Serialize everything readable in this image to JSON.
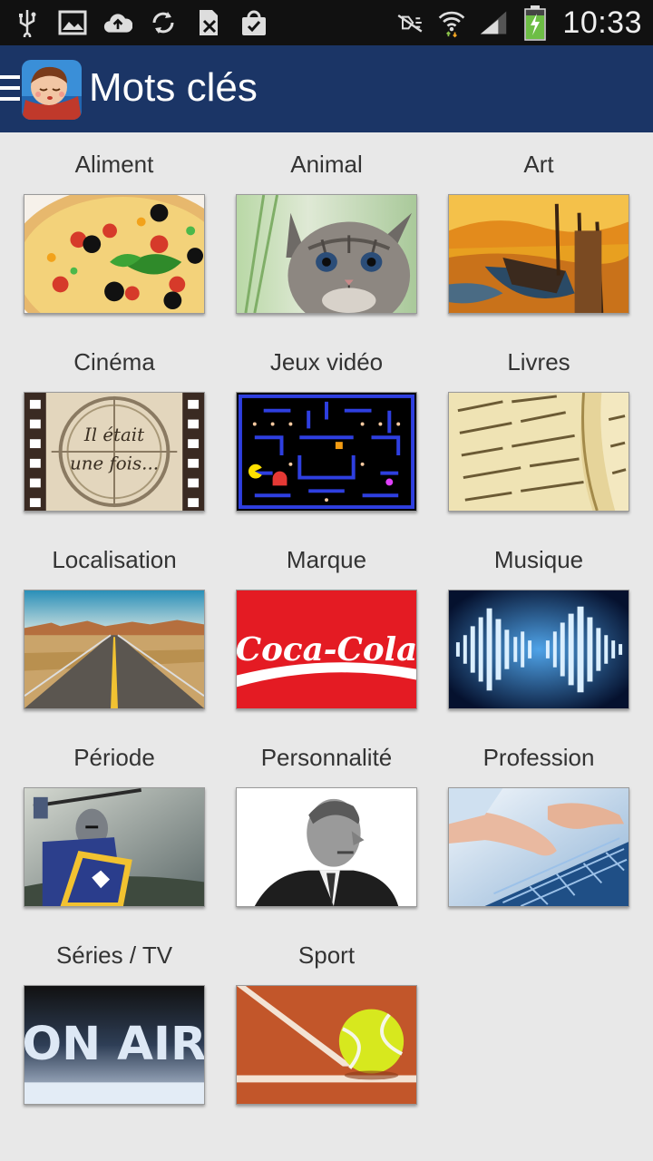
{
  "status_bar": {
    "time": "10:33",
    "icons_left": [
      "usb-icon",
      "image-icon",
      "cloud-upload-icon",
      "sync-icon",
      "sim-card-icon",
      "shopping-bag-icon"
    ],
    "icons_right": [
      "mute-icon",
      "wifi-icon",
      "signal-icon",
      "battery-charging-icon"
    ]
  },
  "action_bar": {
    "title": "Mots clés",
    "background": "#1b3566"
  },
  "categories": [
    {
      "label": "Aliment",
      "image": "pizza"
    },
    {
      "label": "Animal",
      "image": "kitten"
    },
    {
      "label": "Art",
      "image": "painting"
    },
    {
      "label": "Cinéma",
      "image": "film-reel"
    },
    {
      "label": "Jeux vidéo",
      "image": "pacman"
    },
    {
      "label": "Livres",
      "image": "open-book"
    },
    {
      "label": "Localisation",
      "image": "desert-road"
    },
    {
      "label": "Marque",
      "image": "coca-cola-logo"
    },
    {
      "label": "Musique",
      "image": "audio-waves"
    },
    {
      "label": "Période",
      "image": "knight"
    },
    {
      "label": "Personnalité",
      "image": "portrait"
    },
    {
      "label": "Profession",
      "image": "keyboard"
    },
    {
      "label": "Séries / TV",
      "image": "on-air-sign"
    },
    {
      "label": "Sport",
      "image": "tennis-ball"
    }
  ],
  "image_text": {
    "cinema_line1": "Il était",
    "cinema_line2": "une fois...",
    "brand": "Coca-Cola",
    "tv": "ON AIR"
  }
}
